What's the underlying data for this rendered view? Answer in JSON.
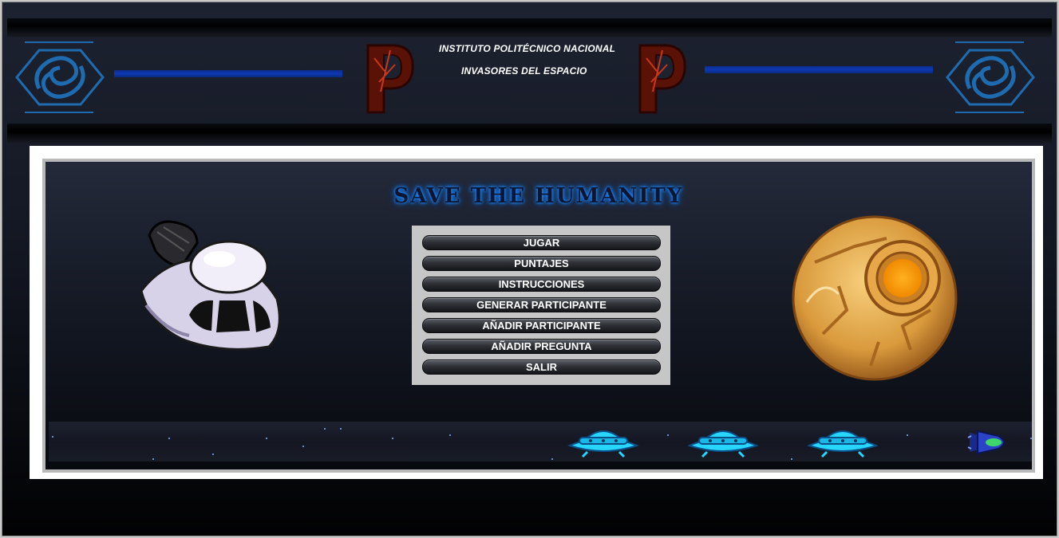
{
  "header": {
    "institution": "INSTITUTO POLITÉCNICO NACIONAL",
    "subtitle": "INVASORES DEL ESPACIO",
    "left_logo_icon": "ipn-logo-icon",
    "right_logo_icon": "ipn-logo-icon",
    "emblem_icon": "p-emblem-icon"
  },
  "game": {
    "title": "SAVE THE HUMANITY",
    "ship_icon": "spaceship-icon",
    "planet_icon": "golden-planet-icon"
  },
  "menu": {
    "items": [
      {
        "label": "JUGAR"
      },
      {
        "label": "PUNTAJES"
      },
      {
        "label": "INSTRUCCIONES"
      },
      {
        "label": "GENERAR PARTICIPANTE"
      },
      {
        "label": "AÑADIR PARTICIPANTE"
      },
      {
        "label": "AÑADIR PREGUNTA"
      },
      {
        "label": "SALIR"
      }
    ]
  },
  "strip": {
    "ufo_icon": "ufo-icon",
    "player_icon": "player-ship-icon"
  },
  "colors": {
    "accent_blue": "#0e38b3",
    "title_glow": "#1a8bff",
    "menu_bg": "#c6c6c6",
    "ufo_cyan": "#27d6ff"
  }
}
